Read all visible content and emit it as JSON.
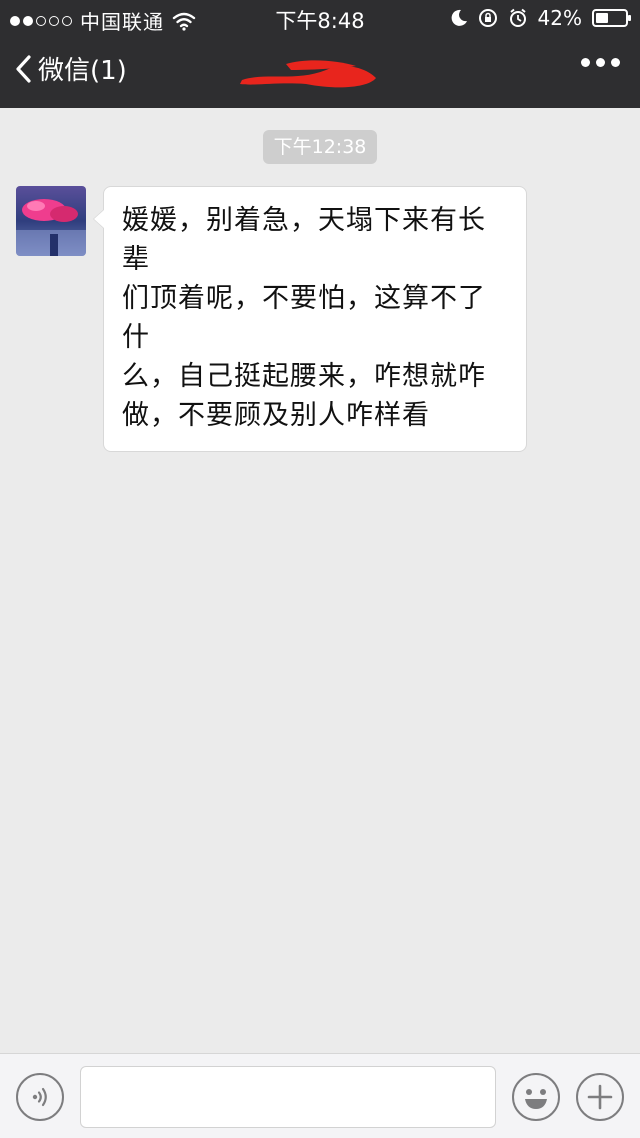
{
  "status_bar": {
    "carrier": "中国联通",
    "time": "下午8:48",
    "battery_percent_label": "42%",
    "battery_level": 0.42,
    "signal_bars_filled": 2,
    "signal_bars_total": 5,
    "icons": [
      "wifi-icon",
      "moon-icon",
      "orientation-lock-icon",
      "alarm-icon",
      "battery-icon"
    ]
  },
  "nav": {
    "back_label": "微信(1)",
    "title_redacted": true,
    "more_icon": "more-dots-icon"
  },
  "chat": {
    "timestamp": "下午12:38",
    "messages": [
      {
        "sender": "contact",
        "lines": [
          "媛媛，别着急，天塌下来有长辈",
          "们顶着呢，不要怕，这算不了什",
          "么，自己挺起腰来，咋想就咋",
          "做，不要顾及别人咋样看"
        ]
      }
    ]
  },
  "input_bar": {
    "voice_icon": "voice-icon",
    "input_value": "",
    "emoji_icon": "emoji-icon",
    "plus_icon": "plus-icon"
  },
  "colors": {
    "header_bg": "#2e2e30",
    "chat_bg": "#ebebeb",
    "bubble_bg": "#ffffff",
    "redaction": "#e8251d"
  }
}
